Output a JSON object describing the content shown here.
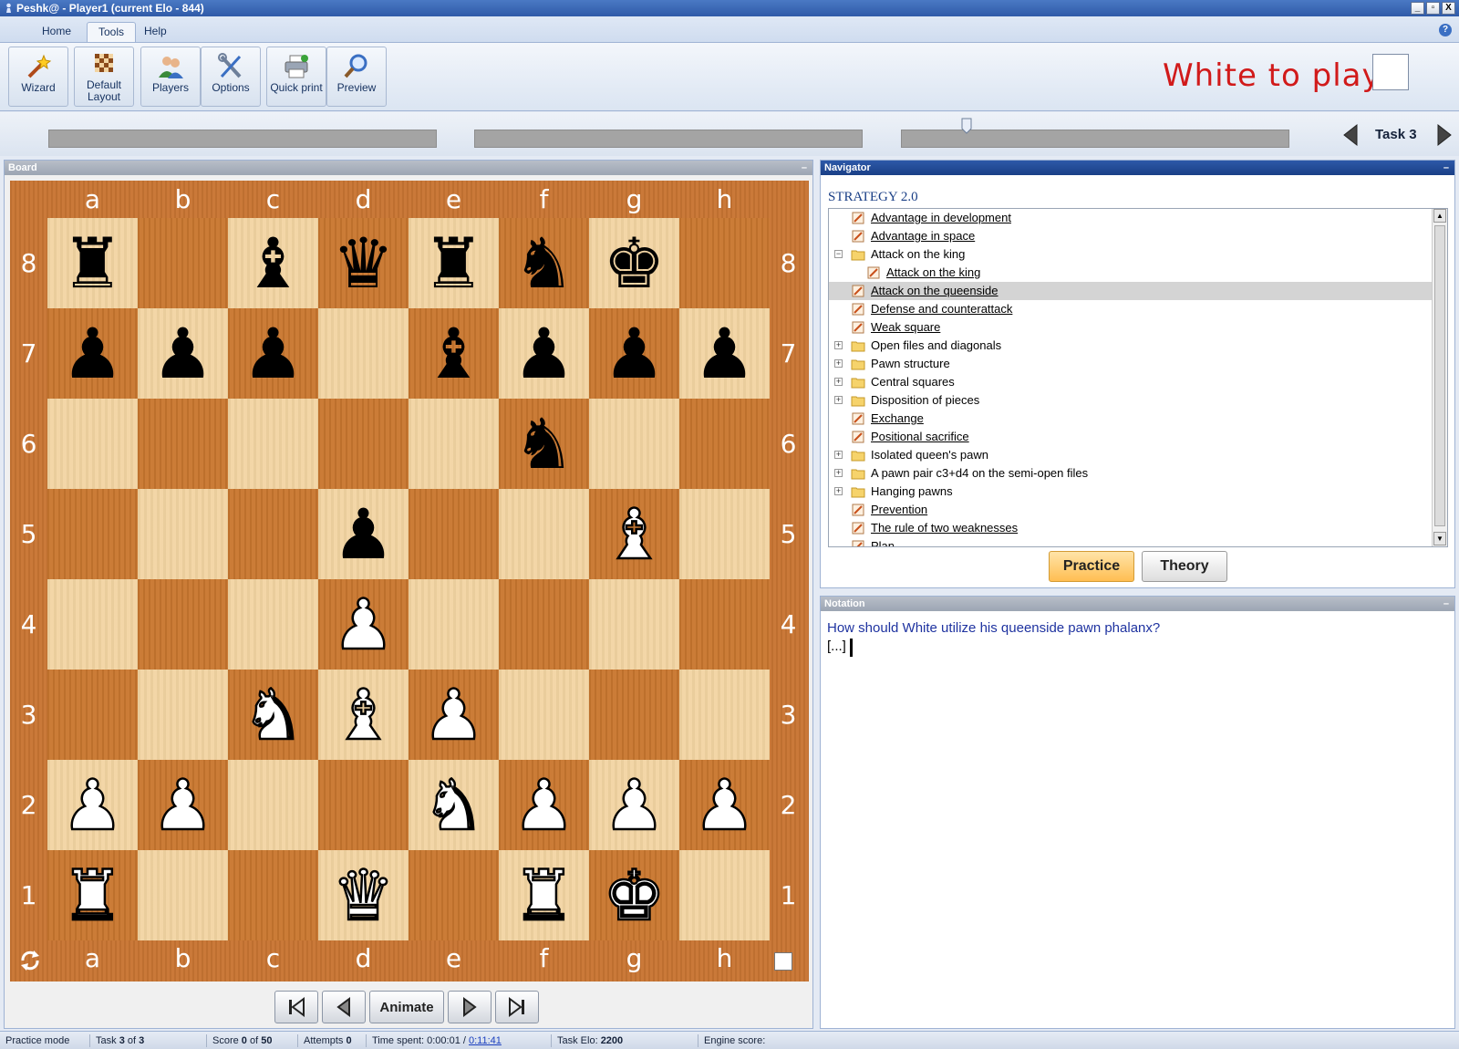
{
  "window": {
    "title": "Peshk@ - Player1 (current Elo - 844)",
    "controls": [
      "_",
      "▫",
      "X"
    ]
  },
  "ribbon": {
    "tabs": [
      "Home",
      "Tools",
      "Help"
    ],
    "active_tab": "Tools",
    "help_icon": "?",
    "buttons": {
      "wizard": "Wizard",
      "default_layout_1": "Default",
      "default_layout_2": "Layout",
      "players": "Players",
      "options": "Options",
      "quick_print": "Quick print",
      "preview": "Preview"
    },
    "to_move": "White to play"
  },
  "progress": {
    "task_label": "Task 3",
    "marker_fraction": 0.74
  },
  "board": {
    "header": "Board",
    "files": [
      "a",
      "b",
      "c",
      "d",
      "e",
      "f",
      "g",
      "h"
    ],
    "ranks": [
      "8",
      "7",
      "6",
      "5",
      "4",
      "3",
      "2",
      "1"
    ],
    "position": [
      [
        "bR",
        "",
        "bB",
        "bQ",
        "bR",
        "bN",
        "bK",
        ""
      ],
      [
        "bP",
        "bP",
        "bP",
        "",
        "bB",
        "bP",
        "bP",
        "bP"
      ],
      [
        "",
        "",
        "",
        "",
        "",
        "bN",
        "",
        ""
      ],
      [
        "",
        "",
        "",
        "bP",
        "",
        "",
        "wB",
        ""
      ],
      [
        "",
        "",
        "",
        "wP",
        "",
        "",
        "",
        ""
      ],
      [
        "",
        "",
        "wN",
        "wB",
        "wP",
        "",
        "",
        ""
      ],
      [
        "wP",
        "wP",
        "",
        "",
        "wN",
        "wP",
        "wP",
        "wP"
      ],
      [
        "wR",
        "",
        "",
        "wQ",
        "",
        "wR",
        "wK",
        ""
      ]
    ],
    "glyphs": {
      "K": "♚",
      "Q": "♛",
      "R": "♜",
      "B": "♝",
      "N": "♞",
      "P": "♟"
    },
    "animate_label": "Animate",
    "colors": {
      "light": "#f2d4a2",
      "dark": "#c9772f",
      "frame": "#c87533"
    }
  },
  "navigator": {
    "header": "Navigator",
    "subtitle": "STRATEGY 2.0",
    "items": [
      {
        "label": "Advantage in development",
        "type": "task",
        "level": 0,
        "expander": ""
      },
      {
        "label": "Advantage in space",
        "type": "task",
        "level": 0,
        "expander": ""
      },
      {
        "label": "Attack on the king",
        "type": "folder",
        "level": 0,
        "expander": "−"
      },
      {
        "label": "Attack on the king",
        "type": "task",
        "level": 1,
        "expander": ""
      },
      {
        "label": "Attack on the queenside",
        "type": "task",
        "level": 0,
        "expander": "",
        "selected": true
      },
      {
        "label": "Defense and counterattack",
        "type": "task",
        "level": 0,
        "expander": ""
      },
      {
        "label": "Weak square",
        "type": "task",
        "level": 0,
        "expander": ""
      },
      {
        "label": "Open files and diagonals",
        "type": "folder",
        "level": 0,
        "expander": "+"
      },
      {
        "label": "Pawn structure",
        "type": "folder",
        "level": 0,
        "expander": "+"
      },
      {
        "label": "Central squares",
        "type": "folder",
        "level": 0,
        "expander": "+"
      },
      {
        "label": "Disposition of pieces",
        "type": "folder",
        "level": 0,
        "expander": "+"
      },
      {
        "label": "Exchange",
        "type": "task",
        "level": 0,
        "expander": ""
      },
      {
        "label": "Positional sacrifice",
        "type": "task",
        "level": 0,
        "expander": ""
      },
      {
        "label": "Isolated queen's pawn",
        "type": "folder",
        "level": 0,
        "expander": "+"
      },
      {
        "label": "A pawn pair c3+d4 on the semi-open files",
        "type": "folder",
        "level": 0,
        "expander": "+"
      },
      {
        "label": "Hanging pawns",
        "type": "folder",
        "level": 0,
        "expander": "+"
      },
      {
        "label": "Prevention",
        "type": "task",
        "level": 0,
        "expander": ""
      },
      {
        "label": "The rule of two weaknesses",
        "type": "task",
        "level": 0,
        "expander": ""
      },
      {
        "label": "Plan",
        "type": "task",
        "level": 0,
        "expander": ""
      }
    ],
    "practice_label": "Practice",
    "theory_label": "Theory"
  },
  "notation": {
    "header": "Notation",
    "question": "How should White utilize his queenside pawn phalanx?",
    "ellipsis": "[...]"
  },
  "status": {
    "mode": "Practice mode",
    "task_prefix": "Task ",
    "task_num": "3",
    "task_mid": " of ",
    "task_total": "3",
    "score_prefix": "Score ",
    "score_val": "0",
    "score_mid": " of ",
    "score_total": "50",
    "attempts_prefix": "Attempts ",
    "attempts_val": "0",
    "time_prefix": "Time spent: 0:00:01 / ",
    "time_total": "0:11:41",
    "elo_prefix": "Task Elo: ",
    "elo_val": "2200",
    "engine": "Engine score:"
  }
}
